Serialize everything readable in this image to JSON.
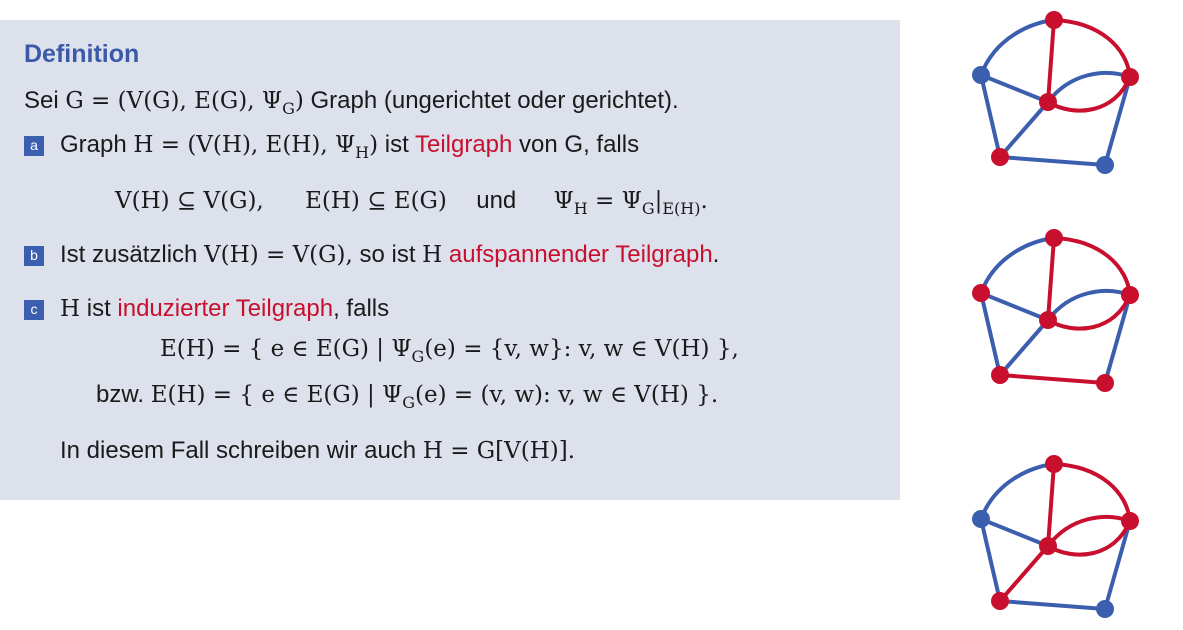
{
  "definition": {
    "title": "Definition",
    "intro": {
      "text_pre": "Sei",
      "math": "G = (V(G), E(G), Ψ",
      "sub": "G",
      "math_post": ")",
      "text_post": "Graph (ungerichtet oder gerichtet)."
    },
    "item_a": {
      "marker": "a",
      "text_pre": "Graph",
      "math_a": "H = (V(H), E(H), Ψ",
      "sub_a": "H",
      "math_a_post": ")",
      "text_mid": "ist",
      "highlight": "Teilgraph",
      "text_post": "von G, falls",
      "formula": {
        "part1": "V(H) ⊆ V(G),",
        "part2": "E(H) ⊆ E(G)",
        "und": "und",
        "part3_pre": "Ψ",
        "part3_sub": "H",
        "part3_mid": " = Ψ",
        "part3_sub2": "G",
        "part3_bar": "|",
        "part3_sub3": "E(H)",
        "part3_end": "."
      }
    },
    "item_b": {
      "marker": "b",
      "text_pre": "Ist zusätzlich",
      "math": "V(H) = V(G),",
      "text_mid": "so ist",
      "math2": "H",
      "highlight": "aufspannender Teilgraph",
      "text_post": "."
    },
    "item_c": {
      "marker": "c",
      "math_pre": "H",
      "text_pre": "ist",
      "highlight": "induzierter Teilgraph",
      "text_post": ", falls",
      "formula1": "E(H) = { e ∈ E(G) | Ψ",
      "formula1_sub": "G",
      "formula1_post": "(e) = {v, w}: v, w ∈ V(H) },",
      "bzw": "bzw.",
      "formula2": "E(H) = { e ∈ E(G) | Ψ",
      "formula2_sub": "G",
      "formula2_post": "(e) = (v, w): v, w ∈ V(H) }.",
      "note_text": "In diesem Fall schreiben wir auch",
      "note_math": "H = G[V(H)]."
    }
  },
  "colors": {
    "accent_red": "#c8102e",
    "accent_blue": "#3a5aa8",
    "box_bg": "#dde1ec"
  }
}
